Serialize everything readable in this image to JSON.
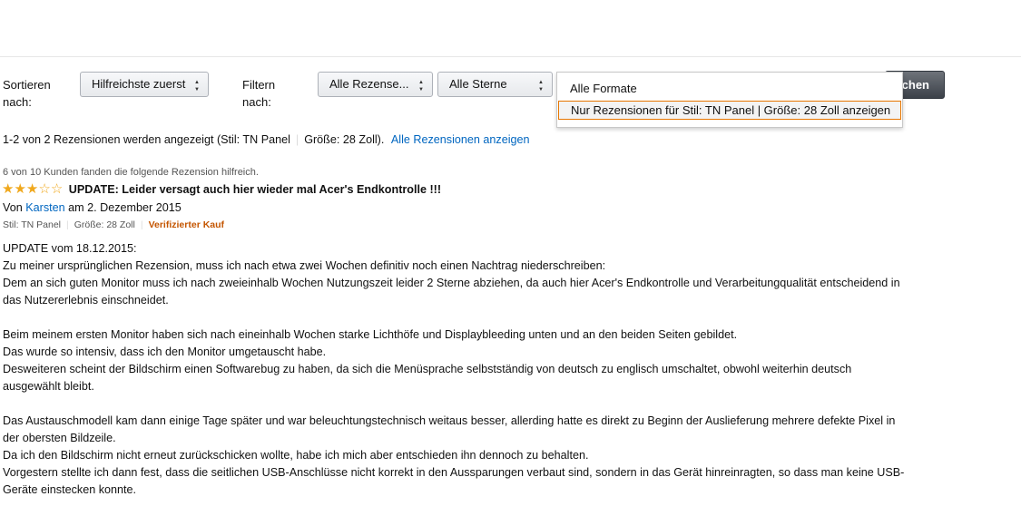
{
  "sort": {
    "label_line1": "Sortieren",
    "label_line2": "nach:",
    "value": "Hilfreichste zuerst"
  },
  "filter": {
    "label_line1": "Filtern",
    "label_line2": "nach:",
    "reviewers_value": "Alle Rezense...",
    "stars_value": "Alle Sterne",
    "format_options": [
      "Alle Formate",
      "Nur Rezensionen für Stil: TN Panel | Größe: 28 Zoll anzeigen"
    ],
    "format_selected_index": 1,
    "search_button_label": "chen"
  },
  "summary": {
    "count_text": "1-2 von 2 Rezensionen werden angezeigt (Stil: TN Panel",
    "size_text": "Größe: 28 Zoll).",
    "show_all_link": "Alle Rezensionen anzeigen"
  },
  "review": {
    "helpful_text": "6 von 10 Kunden fanden die folgende Rezension hilfreich.",
    "rating": 3,
    "max_rating": 5,
    "star_color": "#f0a81d",
    "title": "UPDATE: Leider versagt auch hier wieder mal Acer's Endkontrolle !!!",
    "by_prefix": "Von",
    "author": "Karsten",
    "date": "am 2. Dezember 2015",
    "style": "Stil: TN Panel",
    "size": "Größe: 28 Zoll",
    "verified": "Verifizierter Kauf",
    "verified_color": "#c45500",
    "paragraphs": [
      [
        "UPDATE vom 18.12.2015:",
        "Zu meiner ursprünglichen Rezension, muss ich nach etwa zwei Wochen definitiv noch einen Nachtrag niederschreiben:",
        "Dem an sich guten Monitor muss ich nach zweieinhalb Wochen Nutzungszeit leider 2 Sterne abziehen, da auch hier Acer's Endkontrolle und Verarbeitungqualität entscheidend in",
        "das Nutzererlebnis einschneidet."
      ],
      [
        "Beim meinem ersten Monitor haben sich nach eineinhalb Wochen starke Lichthöfe und Displaybleeding unten und an den beiden Seiten gebildet.",
        "Das wurde so intensiv, dass ich den Monitor umgetauscht habe.",
        "Desweiteren scheint der Bildschirm einen Softwarebug zu haben, da sich die Menüsprache selbstständig von deutsch zu englisch umschaltet, obwohl weiterhin deutsch",
        "ausgewählt bleibt."
      ],
      [
        "Das Austauschmodell kam dann einige Tage später und war beleuchtungstechnisch weitaus besser, allerding hatte es direkt zu Beginn der Auslieferung mehrere defekte Pixel in",
        "der obersten Bildzeile.",
        "Da ich den Bildschirm nicht erneut zurückschicken wollte, habe ich mich aber entschieden ihn dennoch zu behalten.",
        "Vorgestern stellte ich dann fest, dass die seitlichen USB-Anschlüsse nicht korrekt in den Aussparungen verbaut sind, sondern in das Gerät hinreinragten, so dass man keine USB-",
        "Geräte einstecken konnte."
      ]
    ]
  }
}
